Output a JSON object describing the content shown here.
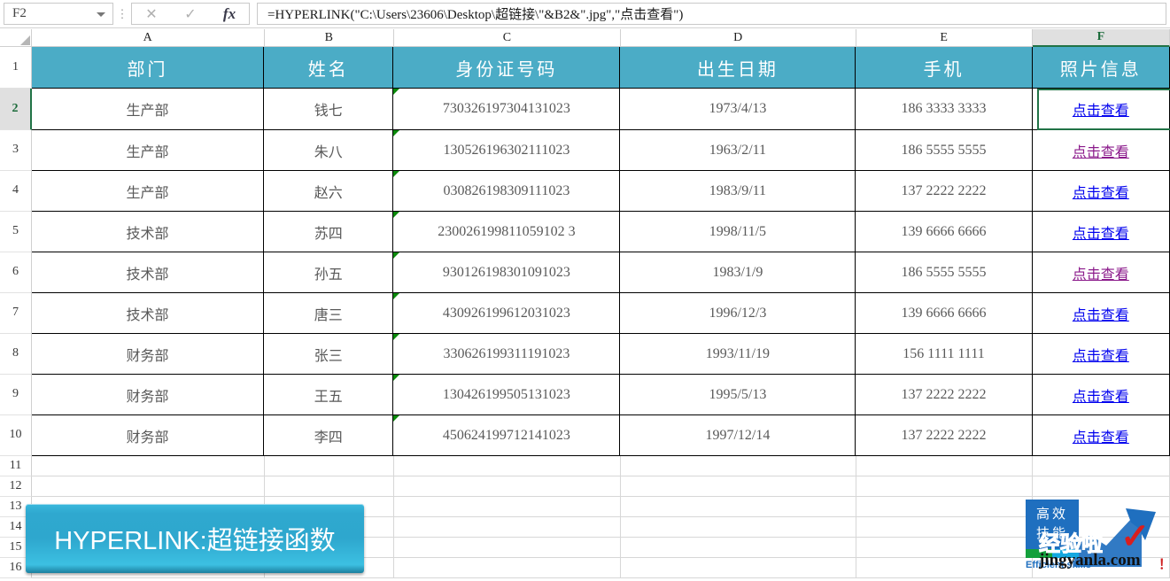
{
  "formula_bar": {
    "name_box_value": "F2",
    "formula": "=HYPERLINK(\"C:\\Users\\23606\\Desktop\\超链接\\\"&B2&\".jpg\",\"点击查看\")",
    "cancel_icon": "close-icon",
    "confirm_icon": "check-icon",
    "function_icon": "fx",
    "fx_label": "fx",
    "cancel_label": "✕",
    "confirm_label": "✓",
    "dropdown_icon": "chevron-down-icon",
    "more_icon": "vertical-dots-icon"
  },
  "grid": {
    "column_headers": [
      "A",
      "B",
      "C",
      "D",
      "E",
      "F"
    ],
    "selected_column": "F",
    "selected_row": "2",
    "selected_cell": "F2",
    "row_numbers": [
      "1",
      "2",
      "3",
      "4",
      "5",
      "6",
      "7",
      "8",
      "9",
      "10",
      "11",
      "12",
      "13",
      "14",
      "15",
      "16"
    ],
    "table_headers": [
      "部门",
      "姓名",
      "身份证号码",
      "出生日期",
      "手机",
      "照片信息"
    ],
    "rows": [
      {
        "dept": "生产部",
        "name": "钱七",
        "id": "730326197304131023",
        "birth": "1973/4/13",
        "phone": "186 3333 3333",
        "link": "点击查看",
        "visited": false
      },
      {
        "dept": "生产部",
        "name": "朱八",
        "id": "130526196302111023",
        "birth": "1963/2/11",
        "phone": "186 5555 5555",
        "link": "点击查看",
        "visited": true
      },
      {
        "dept": "生产部",
        "name": "赵六",
        "id": "030826198309111023",
        "birth": "1983/9/11",
        "phone": "137 2222 2222",
        "link": "点击查看",
        "visited": false
      },
      {
        "dept": "技术部",
        "name": "苏四",
        "id": "230026199811059102 3",
        "birth": "1998/11/5",
        "phone": "139 6666 6666",
        "link": "点击查看",
        "visited": false
      },
      {
        "dept": "技术部",
        "name": "孙五",
        "id": "930126198301091023",
        "birth": "1983/1/9",
        "phone": "186 5555 5555",
        "link": "点击查看",
        "visited": true
      },
      {
        "dept": "技术部",
        "name": "唐三",
        "id": "430926199612031023",
        "birth": "1996/12/3",
        "phone": "139 6666 6666",
        "link": "点击查看",
        "visited": false
      },
      {
        "dept": "财务部",
        "name": "张三",
        "id": "330626199311191023",
        "birth": "1993/11/19",
        "phone": "156 1111 1111",
        "link": "点击查看",
        "visited": false
      },
      {
        "dept": "财务部",
        "name": "王五",
        "id": "130426199505131023",
        "birth": "1995/5/13",
        "phone": "137 2222 2222",
        "link": "点击查看",
        "visited": false
      },
      {
        "dept": "财务部",
        "name": "李四",
        "id": "450624199712141023",
        "birth": "1997/12/14",
        "phone": "137 2222 2222",
        "link": "点击查看",
        "visited": false
      }
    ]
  },
  "banner": {
    "text": "HYPERLINK:超链接函数"
  },
  "watermark": {
    "logo_line1": "高效",
    "logo_line2": "技能",
    "efficient_label": "Efficient skills",
    "brand": "经验啦",
    "url": "jingyanla.com",
    "exclaim": "！",
    "check_mark": "✓"
  },
  "colors": {
    "header_teal": "#4BACC6",
    "selection_green": "#217346",
    "hyperlink_blue": "#0000ee",
    "hyperlink_visited": "#8b1a8b",
    "banner_cyan": "#2ea7ce",
    "error_triangle_green": "#0a8a0a"
  }
}
